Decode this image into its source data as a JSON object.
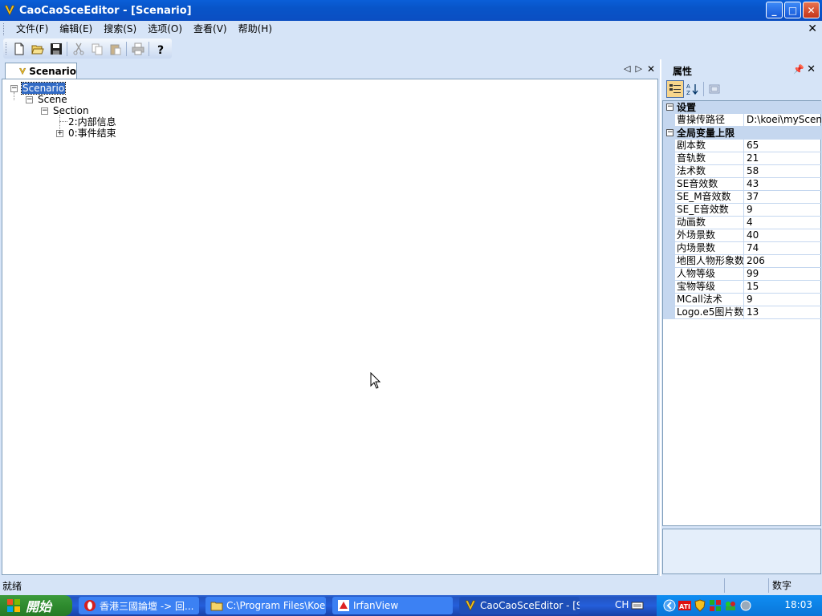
{
  "window": {
    "title": "CaoCaoSceEditor - [Scenario]",
    "controls": {
      "minimize": "_",
      "maximize": "□",
      "close": "✕"
    }
  },
  "menu": {
    "items": [
      "文件(F)",
      "编辑(E)",
      "搜索(S)",
      "选项(O)",
      "查看(V)",
      "帮助(H)"
    ],
    "close": "✕"
  },
  "toolbar": {
    "icons": [
      "new-icon",
      "open-icon",
      "save-icon",
      "cut-icon",
      "copy-icon",
      "paste-icon",
      "print-icon",
      "help-icon"
    ]
  },
  "document": {
    "tab_label": "Scenario",
    "tab_controls": {
      "left": "◁",
      "right": "▷",
      "close": "✕"
    },
    "tree": {
      "root": "Scenario",
      "scene": "Scene",
      "section": "Section",
      "child1": "2:内部信息",
      "child2": "0:事件结束"
    }
  },
  "properties": {
    "title": "属性",
    "pin": "🖈",
    "close": "✕",
    "categories": [
      {
        "name": "设置",
        "rows": [
          {
            "name": "曹操传路径",
            "value": "D:\\koei\\myScen\\"
          }
        ]
      },
      {
        "name": "全局变量上限",
        "rows": [
          {
            "name": "剧本数",
            "value": "65"
          },
          {
            "name": "音轨数",
            "value": "21"
          },
          {
            "name": "法术数",
            "value": "58"
          },
          {
            "name": "SE音效数",
            "value": "43"
          },
          {
            "name": "SE_M音效数",
            "value": "37"
          },
          {
            "name": "SE_E音效数",
            "value": "9"
          },
          {
            "name": "动画数",
            "value": "4"
          },
          {
            "name": "外场景数",
            "value": "40"
          },
          {
            "name": "内场景数",
            "value": "74"
          },
          {
            "name": "地图人物形象数",
            "value": "206"
          },
          {
            "name": "人物等级",
            "value": "99"
          },
          {
            "name": "宝物等级",
            "value": "15"
          },
          {
            "name": "MCall法术",
            "value": "9"
          },
          {
            "name": "Logo.e5图片数",
            "value": "13"
          }
        ]
      }
    ]
  },
  "status": {
    "left": "就绪",
    "right": "数字"
  },
  "taskbar": {
    "start": "開始",
    "tasks": [
      {
        "label": "香港三國論壇 -> 回...",
        "icon": "opera-icon"
      },
      {
        "label": "C:\\Program Files\\Koei\\...",
        "icon": "folder-icon"
      },
      {
        "label": "IrfanView",
        "icon": "irfanview-icon"
      },
      {
        "label": "CaoCaoSceEditor - [S...",
        "icon": "app-icon",
        "active": true
      }
    ],
    "lang": "CH",
    "clock": "18:03"
  }
}
